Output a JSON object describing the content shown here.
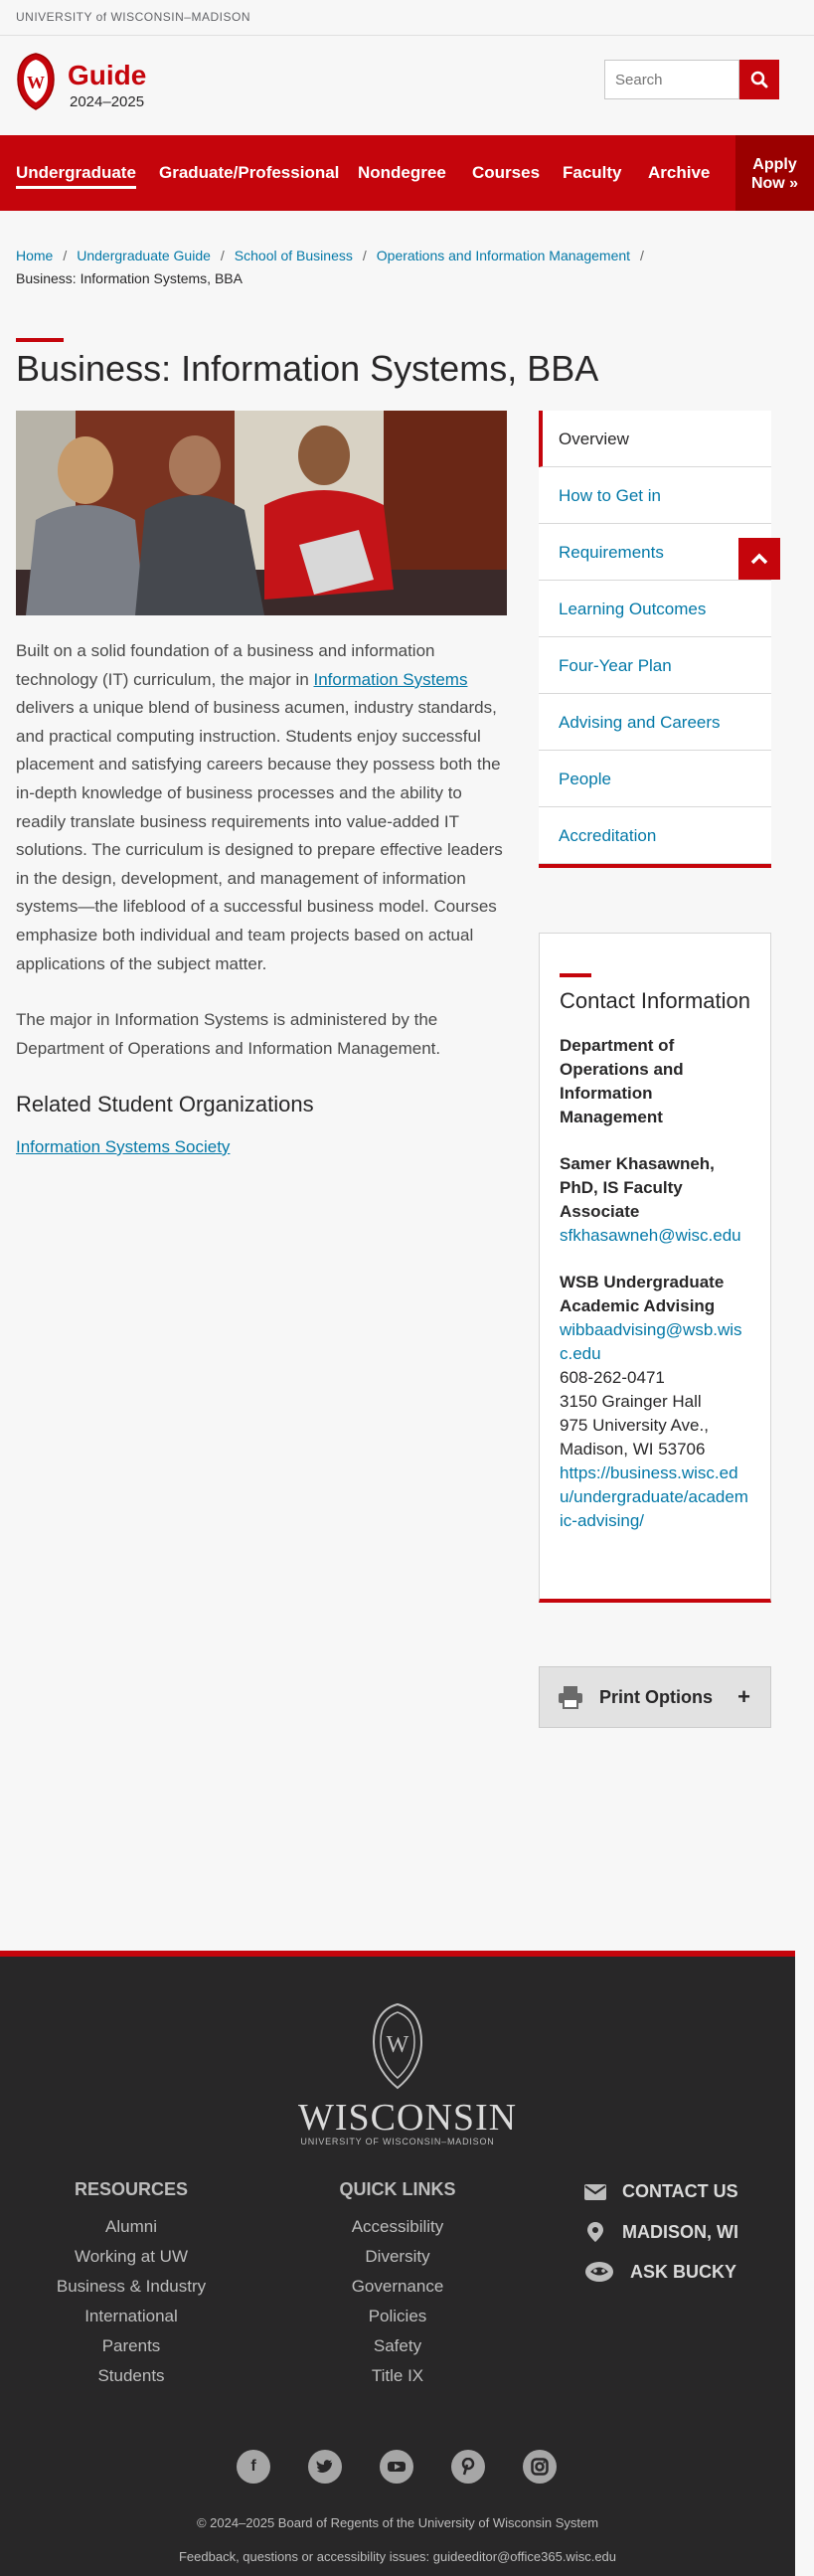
{
  "topbar": {
    "university": "UNIVERSITY of WISCONSIN–MADISON"
  },
  "header": {
    "title": "Guide",
    "years": "2024–2025",
    "search_placeholder": "Search"
  },
  "nav": {
    "items": [
      "Undergraduate",
      "Graduate/Professional",
      "Nondegree",
      "Courses",
      "Faculty",
      "Archive"
    ],
    "apply_line1": "Apply",
    "apply_line2": "Now »"
  },
  "breadcrumb": {
    "items": [
      "Home",
      "Undergraduate Guide",
      "School of Business",
      "Operations and Information Management"
    ],
    "separator": "/",
    "current": "Business: Information Systems, BBA"
  },
  "page": {
    "title": "Business: Information Systems, BBA",
    "intro_before": "Built on a solid foundation of a business and information technology (IT) curriculum, the major in ",
    "intro_link": "Information Systems",
    "intro_after": " delivers a unique blend of business acumen, industry standards, and practical computing instruction. Students enjoy successful placement and satisfying careers because they possess both the in-depth knowledge of business processes and the ability to readily translate business requirements into value-added IT solutions. The curriculum is designed to prepare effective leaders in the design, development, and management of information systems—the lifeblood of a successful business model. Courses emphasize both individual and team projects based on actual applications of the subject matter.",
    "admin_text": "The major in Information Systems is administered by the Department of Operations and Information Management.",
    "related_heading": "Related Student Organizations",
    "related_link": "Information Systems Society"
  },
  "sidenav": {
    "items": [
      "Overview",
      "How to Get in",
      "Requirements",
      "Learning Outcomes",
      "Four-Year Plan",
      "Advising and Careers",
      "People",
      "Accreditation"
    ]
  },
  "contact": {
    "heading": "Contact Information",
    "dept": "Department of Operations and Information Management",
    "person_name": "Samer Khasawneh, PhD, IS Faculty Associate",
    "person_email": "sfkhasawneh@wisc.edu",
    "advising_name": "WSB Undergraduate Academic Advising",
    "advising_email": "wibbaadvising@wsb.wisc.edu",
    "phone": "608-262-0471",
    "address1": "3150 Grainger Hall",
    "address2": "975 University Ave.,",
    "address3": "Madison, WI 53706",
    "url": "https://business.wisc.edu/undergraduate/academic-advising/"
  },
  "print": {
    "label": "Print Options",
    "plus": "+"
  },
  "footer": {
    "wordmark": "WISCONSIN",
    "subwordmark": "UNIVERSITY OF WISCONSIN–MADISON",
    "resources_heading": "RESOURCES",
    "resources": [
      "Alumni",
      "Working at UW",
      "Business & Industry",
      "International",
      "Parents",
      "Students"
    ],
    "quicklinks_heading": "QUICK LINKS",
    "quicklinks": [
      "Accessibility",
      "Diversity",
      "Governance",
      "Policies",
      "Safety",
      "Title IX"
    ],
    "contact_us": "CONTACT US",
    "location": "MADISON, WI",
    "ask_bucky": "ASK BUCKY",
    "socials": [
      "facebook-icon",
      "twitter-icon",
      "youtube-icon",
      "pinterest-icon",
      "instagram-icon"
    ],
    "copyright": "© 2024–2025 Board of Regents of the University of Wisconsin System",
    "feedback": "Feedback, questions or accessibility issues: guideeditor@office365.wisc.edu"
  },
  "colors": {
    "brand_red": "#c5050c",
    "link_blue": "#0479a8",
    "footer_bg": "#282728"
  }
}
